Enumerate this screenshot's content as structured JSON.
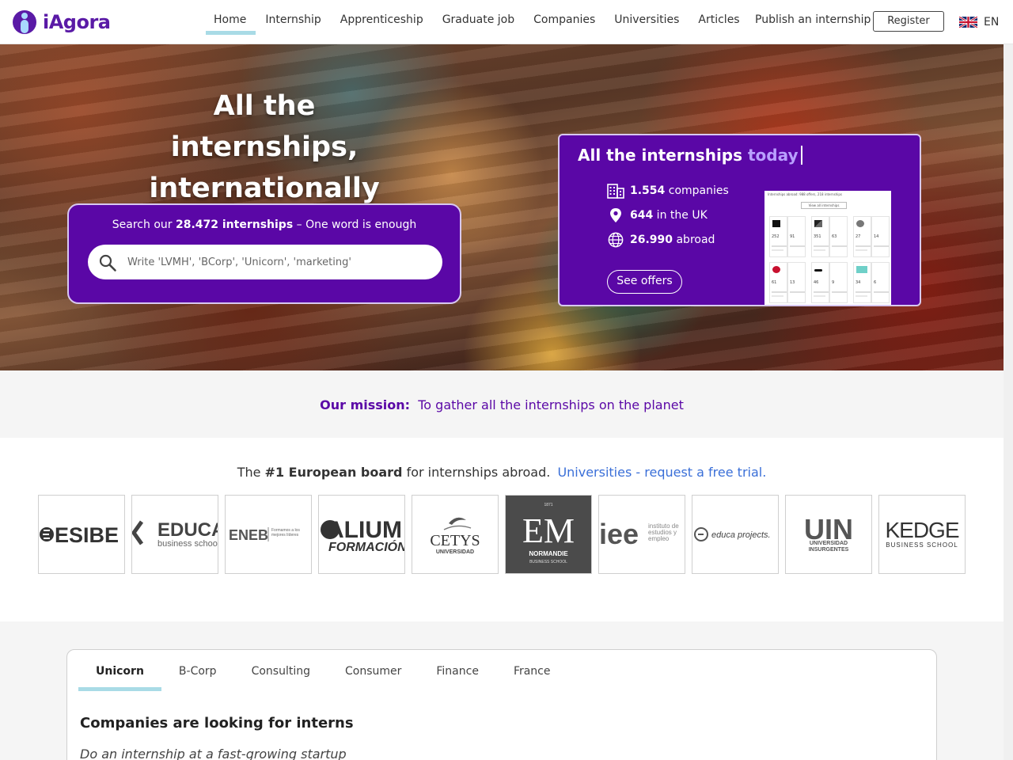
{
  "header": {
    "brand": "iAgora",
    "nav": [
      {
        "label": "Home",
        "active": true
      },
      {
        "label": "Internship"
      },
      {
        "label": "Apprenticeship"
      },
      {
        "label": "Graduate job"
      },
      {
        "label": "Companies"
      },
      {
        "label": "Universities"
      },
      {
        "label": "Articles"
      }
    ],
    "publish": "Publish an internship",
    "register": "Register",
    "lang": "EN"
  },
  "hero": {
    "title_line1": "All the internships,",
    "title_line2": "internationally",
    "search": {
      "prefix": "Search our ",
      "count": "28.472 internships",
      "suffix": " – One word is enough",
      "placeholder": "Write 'LVMH', 'BCorp', 'Unicorn', 'marketing'"
    },
    "stats": {
      "title": "All the internships",
      "title_accent": "today",
      "companies_value": "1.554",
      "companies_label": " companies",
      "uk_value": "644",
      "uk_label": " in the UK",
      "abroad_value": "26.990",
      "abroad_label": " abroad",
      "cta": "See offers",
      "preview": {
        "header": "Internships abroad: 988 offers, 218 internships",
        "button": "View all internships",
        "tiles": [
          {
            "a": "252",
            "b": "91"
          },
          {
            "a": "351",
            "b": "63"
          },
          {
            "a": "27",
            "b": "14"
          },
          {
            "a": "61",
            "b": "13"
          },
          {
            "a": "46",
            "b": "9"
          },
          {
            "a": "34",
            "b": "6"
          }
        ]
      }
    }
  },
  "mission": {
    "label": "Our mission:",
    "text": "To gather all the internships on the planet"
  },
  "schools": {
    "prefix": "The ",
    "bold": "#1 European board",
    "suffix": " for internships abroad.",
    "link": "Universities - request a free trial.",
    "logos": [
      {
        "text": "ESIBE"
      },
      {
        "text": "EDUCA",
        "sub": "business school"
      },
      {
        "text": "ENEB",
        "sub": "Formamos a los mejores líderes"
      },
      {
        "text": "ALIUM",
        "sub": "FORMACIÓN"
      },
      {
        "text": "CETYS",
        "sub": "UNIVERSIDAD"
      },
      {
        "text": "EM",
        "sub": "NORMANDIE",
        "sub2": "BUSINESS SCHOOL",
        "top": "1871"
      },
      {
        "text": "iee",
        "sub": "instituto de estudios y empleo"
      },
      {
        "text": "educa projects."
      },
      {
        "text": "UIN",
        "sub": "UNIVERSIDAD INSURGENTES"
      },
      {
        "text": "KEDGE",
        "sub": "BUSINESS SCHOOL"
      }
    ]
  },
  "categories": {
    "tabs": [
      "Unicorn",
      "B-Corp",
      "Consulting",
      "Consumer",
      "Finance",
      "France"
    ],
    "active": "Unicorn",
    "heading": "Companies are looking for interns",
    "subheading": "Do an internship at a fast-growing startup"
  },
  "colors": {
    "brand_purple": "#5a07a6",
    "tab_underline": "#a9dbe6",
    "link_blue": "#3a6fd8"
  }
}
